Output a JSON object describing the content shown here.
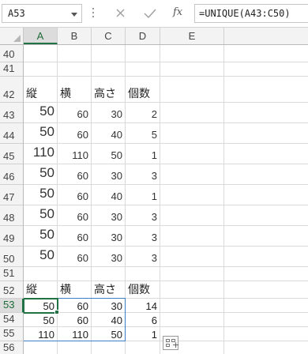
{
  "formula_bar": {
    "name_box": "A53",
    "fx_label": "fx",
    "formula": "=UNIQUE(A43:C50)"
  },
  "columns": [
    "A",
    "B",
    "C",
    "D",
    "E"
  ],
  "rows": [
    "40",
    "41",
    "42",
    "43",
    "44",
    "45",
    "46",
    "47",
    "48",
    "49",
    "50",
    "51",
    "52",
    "53",
    "54",
    "55",
    "56"
  ],
  "active_cell": "A53",
  "source_table": {
    "headers": [
      "縦",
      "横",
      "高さ",
      "個数"
    ],
    "data": [
      [
        "50",
        "60",
        "30",
        "2"
      ],
      [
        "50",
        "60",
        "40",
        "5"
      ],
      [
        "110",
        "110",
        "50",
        "1"
      ],
      [
        "50",
        "60",
        "30",
        "3"
      ],
      [
        "50",
        "60",
        "40",
        "1"
      ],
      [
        "50",
        "60",
        "30",
        "3"
      ],
      [
        "50",
        "60",
        "30",
        "3"
      ],
      [
        "50",
        "60",
        "30",
        "3"
      ]
    ]
  },
  "result_table": {
    "headers": [
      "縦",
      "横",
      "高さ",
      "個数"
    ],
    "data": [
      [
        "50",
        "60",
        "30",
        "14"
      ],
      [
        "50",
        "60",
        "40",
        "6"
      ],
      [
        "110",
        "110",
        "50",
        "1"
      ]
    ]
  },
  "icons": {
    "cancel": "cancel-icon",
    "enter": "enter-icon",
    "fx": "fx-icon",
    "quick_analysis": "quick-analysis-icon"
  },
  "colors": {
    "header_active_text": "#1e6b3a",
    "selection": "#217346",
    "spill_border": "#3d80c8"
  }
}
